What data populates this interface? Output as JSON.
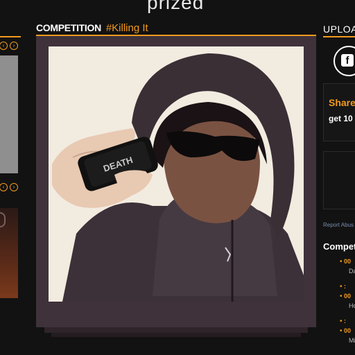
{
  "header": {
    "logo": "prized"
  },
  "left": {
    "nav_prev": "‹",
    "nav_next": "›"
  },
  "main": {
    "competition_label": "COMPETITION",
    "competition_tag": "#Killing It",
    "photo_phone_text": "DEATH"
  },
  "right": {
    "upload_label": "UPLOA",
    "share_title": "Share",
    "share_sub": "get 10",
    "report": "Report Abus",
    "competitions_title": "Compet",
    "items": [
      {
        "countdown": "00",
        "name": "Da"
      },
      {
        "countdown": ":",
        "name": ""
      },
      {
        "countdown": "00",
        "name": "Ho"
      },
      {
        "countdown": ":",
        "name": ""
      },
      {
        "countdown": "00",
        "name": "Mi"
      }
    ]
  },
  "colors": {
    "accent": "#f39a1e",
    "frame": "#3f323b",
    "background": "#121212"
  }
}
